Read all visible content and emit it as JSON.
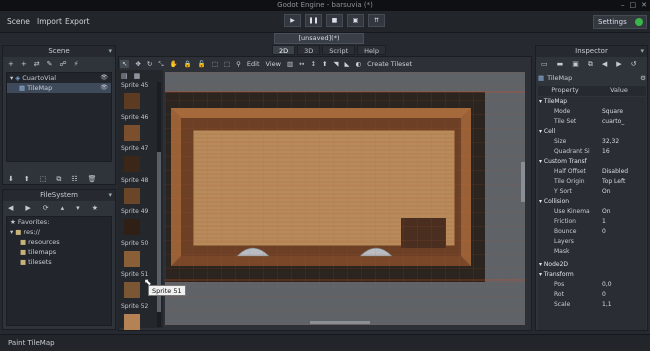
{
  "window": {
    "title": "Godot Engine - barsuvia (*)",
    "controls": [
      "–",
      "□",
      "✕"
    ]
  },
  "menus": [
    "Scene",
    "Import",
    "Export"
  ],
  "play": [
    "▶",
    "❚❚",
    "■",
    "▣",
    "⇈"
  ],
  "settings": "Settings",
  "scene_tab": "[unsaved](*)",
  "scene_dock": {
    "title": "Scene",
    "tools": [
      "+",
      "+",
      "⇄",
      "✎",
      "☍",
      "⚡"
    ],
    "nodes": [
      {
        "label": "CuartoVial",
        "eye": "👁"
      },
      {
        "label": "TileMap",
        "eye": "👁"
      }
    ],
    "bottom_tools": [
      "⬇",
      "⬆",
      "⬚",
      "⧉",
      "☷",
      "🗑"
    ]
  },
  "filesystem": {
    "title": "FileSystem",
    "tools": [
      "◀",
      "▶",
      "⟳",
      "▴",
      "▾",
      "★"
    ],
    "items": [
      "Favorites:",
      "res://",
      "resources",
      "tilemaps",
      "tilesets"
    ]
  },
  "viewport": {
    "tabs": [
      "2D",
      "3D",
      "Script",
      "Help"
    ],
    "menu": [
      "Edit",
      "View"
    ],
    "create_tileset": "Create Tileset"
  },
  "tiles": [
    "Sprite 45",
    "Sprite 46",
    "Sprite 47",
    "Sprite 48",
    "Sprite 49",
    "Sprite 50",
    "Sprite 51",
    "Sprite 52"
  ],
  "tooltip": "Sprite 51",
  "inspector": {
    "title": "Inspector",
    "node_name": "TileMap",
    "col_property": "Property",
    "col_value": "Value",
    "sections": [
      "TileMap",
      "Cell",
      "Custom Transf",
      "Collision",
      "Node2D",
      "Transform"
    ],
    "rows": [
      {
        "p": "Mode",
        "v": "Square"
      },
      {
        "p": "Tile Set",
        "v": "cuarto_"
      },
      {
        "p": "Size",
        "v": "32,32"
      },
      {
        "p": "Quadrant Si",
        "v": "16"
      },
      {
        "p": "Half Offset",
        "v": "Disabled"
      },
      {
        "p": "Tile Origin",
        "v": "Top Left"
      },
      {
        "p": "Y Sort",
        "v": "On"
      },
      {
        "p": "Use Kinema",
        "v": "On"
      },
      {
        "p": "Friction",
        "v": "1"
      },
      {
        "p": "Bounce",
        "v": "0"
      },
      {
        "p": "Layers",
        "v": ""
      },
      {
        "p": "Mask",
        "v": ""
      },
      {
        "p": "Pos",
        "v": "0,0"
      },
      {
        "p": "Rot",
        "v": "0"
      },
      {
        "p": "Scale",
        "v": "1,1"
      }
    ]
  },
  "status": "Paint TileMap",
  "colors": {
    "accent": "#3e4a5a",
    "floor": "#bb8e5e",
    "wall": "#8a5630",
    "dark": "#2a231e"
  }
}
